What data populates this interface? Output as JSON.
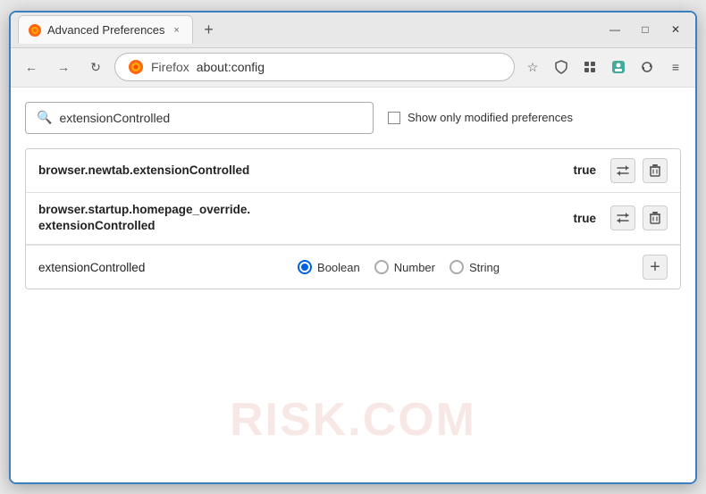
{
  "window": {
    "title": "Advanced Preferences",
    "tab_close": "×",
    "new_tab": "+",
    "minimize": "—",
    "maximize": "□",
    "close": "✕"
  },
  "nav": {
    "back": "←",
    "forward": "→",
    "refresh": "↻",
    "firefox_label": "Firefox",
    "address": "about:config",
    "bookmark": "☆",
    "shield": "🛡",
    "extensions_icon": "🧩",
    "profile_icon": "👤",
    "sync_icon": "⟳",
    "menu": "≡"
  },
  "search": {
    "placeholder": "extensionControlled",
    "value": "extensionControlled",
    "checkbox_label": "Show only modified preferences"
  },
  "preferences": [
    {
      "name": "browser.newtab.extensionControlled",
      "value": "true"
    },
    {
      "name": "browser.startup.homepage_override.\nextensionControlled",
      "name_line1": "browser.startup.homepage_override.",
      "name_line2": "extensionControlled",
      "value": "true"
    }
  ],
  "add_row": {
    "name": "extensionControlled",
    "types": [
      "Boolean",
      "Number",
      "String"
    ],
    "selected_type": "Boolean",
    "add_btn": "+"
  },
  "watermark": "RISK.COM",
  "icons": {
    "search": "🔍",
    "toggle": "⇄",
    "delete": "🗑"
  }
}
